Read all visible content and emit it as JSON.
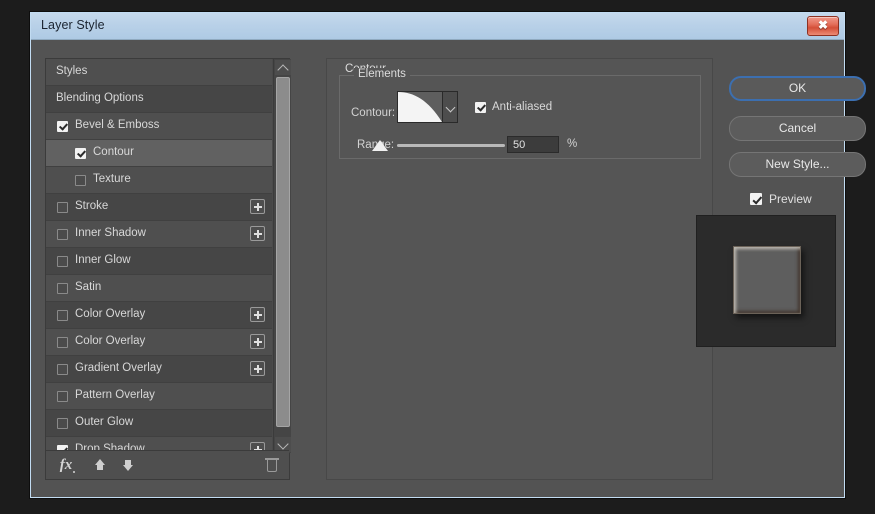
{
  "window": {
    "title": "Layer Style",
    "close_label": "✖"
  },
  "styles_list": {
    "items": [
      {
        "label": "Styles",
        "checkbox": "none",
        "indent": false,
        "has_plus": false,
        "selected": false
      },
      {
        "label": "Blending Options",
        "checkbox": "none",
        "indent": false,
        "has_plus": false,
        "selected": false
      },
      {
        "label": "Bevel & Emboss",
        "checkbox": "checked",
        "indent": false,
        "has_plus": false,
        "selected": false
      },
      {
        "label": "Contour",
        "checkbox": "checked",
        "indent": true,
        "has_plus": false,
        "selected": true
      },
      {
        "label": "Texture",
        "checkbox": "unchecked",
        "indent": true,
        "has_plus": false,
        "selected": false
      },
      {
        "label": "Stroke",
        "checkbox": "unchecked",
        "indent": false,
        "has_plus": true,
        "selected": false
      },
      {
        "label": "Inner Shadow",
        "checkbox": "unchecked",
        "indent": false,
        "has_plus": true,
        "selected": false
      },
      {
        "label": "Inner Glow",
        "checkbox": "unchecked",
        "indent": false,
        "has_plus": false,
        "selected": false
      },
      {
        "label": "Satin",
        "checkbox": "unchecked",
        "indent": false,
        "has_plus": false,
        "selected": false
      },
      {
        "label": "Color Overlay",
        "checkbox": "unchecked",
        "indent": false,
        "has_plus": true,
        "selected": false
      },
      {
        "label": "Color Overlay",
        "checkbox": "unchecked",
        "indent": false,
        "has_plus": true,
        "selected": false
      },
      {
        "label": "Gradient Overlay",
        "checkbox": "unchecked",
        "indent": false,
        "has_plus": true,
        "selected": false
      },
      {
        "label": "Pattern Overlay",
        "checkbox": "unchecked",
        "indent": false,
        "has_plus": false,
        "selected": false
      },
      {
        "label": "Outer Glow",
        "checkbox": "unchecked",
        "indent": false,
        "has_plus": false,
        "selected": false
      },
      {
        "label": "Drop Shadow",
        "checkbox": "checked",
        "indent": false,
        "has_plus": true,
        "selected": false
      }
    ],
    "toolbar": {
      "fx_label": "fx",
      "move_up_icon": "arrow-up-icon",
      "move_down_icon": "arrow-down-icon",
      "delete_icon": "trash-icon"
    },
    "scrollbar": {
      "up_icon": "chevron-up-icon",
      "down_icon": "chevron-down-icon"
    }
  },
  "contour_panel": {
    "title": "Contour",
    "elements_legend": "Elements",
    "contour_label": "Contour:",
    "contour_preview_name": "contour-curve-preview",
    "dropdown_icon": "chevron-down-icon",
    "anti_aliased_label": "Anti-aliased",
    "anti_aliased_checked": true,
    "range_label": "Range:",
    "range_value": "50",
    "range_unit": "%"
  },
  "actions": {
    "ok_label": "OK",
    "cancel_label": "Cancel",
    "new_style_label": "New Style...",
    "preview_label": "Preview",
    "preview_checked": true
  },
  "colors": {
    "dialog_bg": "#535353",
    "panel_bg": "#555555",
    "titlebar": "#bcd3e8",
    "focus_ring": "#3c6fb0",
    "close_red": "#d44f38",
    "text": "#d8d8d8"
  }
}
